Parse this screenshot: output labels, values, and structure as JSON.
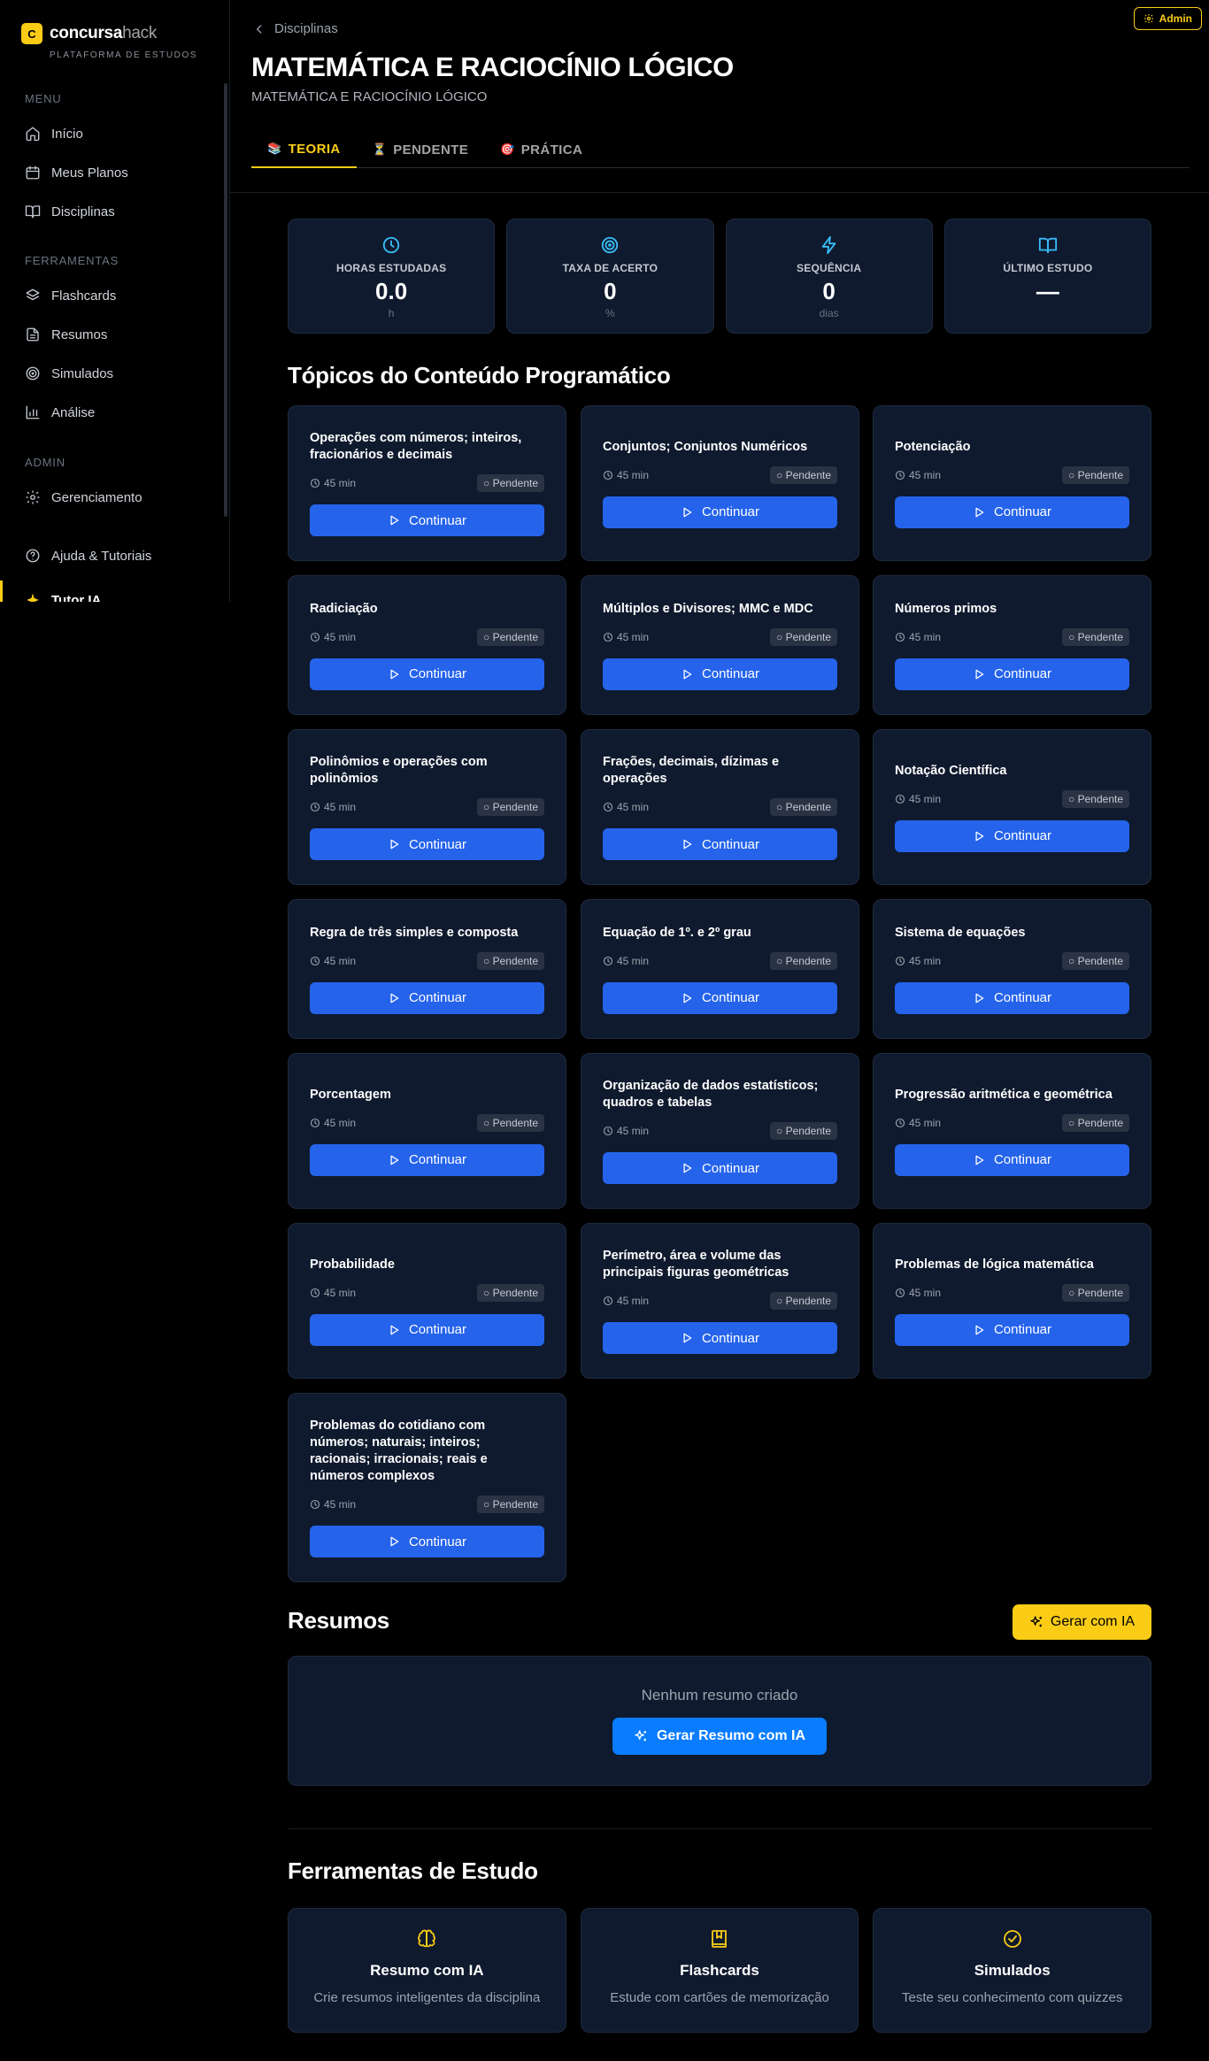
{
  "sidebar": {
    "logo_mark": "C",
    "logo_part1": "concursa",
    "logo_part2": "hack",
    "logo_sub": "PLATAFORMA DE ESTUDOS",
    "menu_label": "MENU",
    "ferramentas_label": "FERRAMENTAS",
    "admin_label": "ADMIN",
    "items": [
      {
        "label": "Início",
        "icon": "home-icon"
      },
      {
        "label": "Meus Planos",
        "icon": "calendar-icon"
      },
      {
        "label": "Disciplinas",
        "icon": "book-open-icon"
      },
      {
        "label": "Flashcards",
        "icon": "layers-icon"
      },
      {
        "label": "Resumos",
        "icon": "file-text-icon"
      },
      {
        "label": "Simulados",
        "icon": "target-icon"
      },
      {
        "label": "Análise",
        "icon": "bar-chart-icon"
      },
      {
        "label": "Gerenciamento",
        "icon": "gear-icon"
      },
      {
        "label": "Ajuda & Tutoriais",
        "icon": "help-circle-icon"
      },
      {
        "label": "Tutor IA",
        "icon": "sparkle-icon"
      }
    ]
  },
  "header": {
    "breadcrumb": "Disciplinas",
    "admin_badge": "Admin",
    "title": "MATEMÁTICA E RACIOCÍNIO LÓGICO",
    "subtitle": "MATEMÁTICA E RACIOCÍNIO LÓGICO",
    "tabs": [
      {
        "label": "TEORIA",
        "emoji": "📚"
      },
      {
        "label": "PENDENTE",
        "emoji": "⏳"
      },
      {
        "label": "PRÁTICA",
        "emoji": "🎯"
      }
    ]
  },
  "stats": [
    {
      "label": "HORAS ESTUDADAS",
      "value": "0.0",
      "unit": "h",
      "icon": "clock-icon"
    },
    {
      "label": "TAXA DE ACERTO",
      "value": "0",
      "unit": "%",
      "icon": "target-icon"
    },
    {
      "label": "SEQUÊNCIA",
      "value": "0",
      "unit": "dias",
      "icon": "zap-icon"
    },
    {
      "label": "ÚLTIMO ESTUDO",
      "value": "—",
      "unit": "",
      "icon": "book-open-icon"
    }
  ],
  "topics_title": "Tópicos do Conteúdo Programático",
  "topic_duration": "45 min",
  "topic_status": "○ Pendente",
  "continue_label": "Continuar",
  "topics": [
    "Operações com números; inteiros, fracionários e decimais",
    "Conjuntos; Conjuntos Numéricos",
    "Potenciação",
    "Radiciação",
    "Múltiplos e Divisores; MMC e MDC",
    "Números primos",
    "Polinômios e operações com polinômios",
    "Frações, decimais, dízimas e operações",
    "Notação Científica",
    "Regra de três simples e composta",
    "Equação de 1º. e 2º grau",
    "Sistema de equações",
    "Porcentagem",
    "Organização de dados estatísticos; quadros e tabelas",
    "Progressão aritmética e geométrica",
    "Probabilidade",
    "Perímetro, área e volume das principais figuras geométricas",
    "Problemas de lógica matemática",
    "Problemas do cotidiano com números; naturais; inteiros; racionais; irracionais; reais e números complexos"
  ],
  "resumos": {
    "title": "Resumos",
    "generate_button": "Gerar com IA",
    "empty_message": "Nenhum resumo criado",
    "generate_resumo_button": "Gerar Resumo com IA"
  },
  "tools": {
    "title": "Ferramentas de Estudo",
    "items": [
      {
        "title": "Resumo com IA",
        "desc": "Crie resumos inteligentes da disciplina",
        "icon": "brain-icon",
        "color": "#facc15"
      },
      {
        "title": "Flashcards",
        "desc": "Estude com cartões de memorização",
        "icon": "bookmark-book-icon",
        "color": "#facc15"
      },
      {
        "title": "Simulados",
        "desc": "Teste seu conhecimento com quizzes",
        "icon": "check-circle-icon",
        "color": "#facc15"
      }
    ]
  },
  "colors": {
    "accent": "#facc15",
    "primary_button": "#2563eb",
    "card_bg": "#0f1a2e",
    "stat_icon": "#38bdf8"
  }
}
